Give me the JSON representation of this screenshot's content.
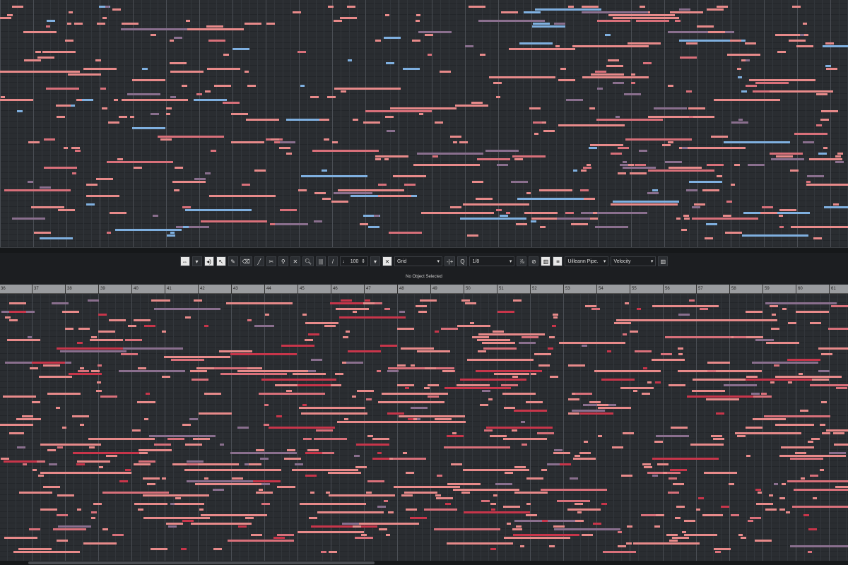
{
  "toolbar": {
    "nudge_value": "100",
    "snap_mode": "Grid",
    "quantize_label": "Q",
    "quantize_value": "1/8",
    "instrument": "Uilleann Pipe.",
    "controller_lane": "Velocity"
  },
  "info_line": {
    "status": "No Object Selected"
  },
  "ruler": {
    "bars": [
      "36",
      "37",
      "38",
      "39",
      "40",
      "41",
      "42",
      "43",
      "44",
      "45",
      "46",
      "47",
      "48",
      "49",
      "50",
      "51",
      "52",
      "53",
      "54",
      "55",
      "56",
      "57",
      "58",
      "59",
      "60",
      "61"
    ]
  },
  "colors": {
    "note_light": "#e88a8a",
    "note_red": "#c8354a",
    "note_mauve": "#8a6f8e",
    "note_blue": "#7fb0e0",
    "background": "#2a2d31"
  }
}
